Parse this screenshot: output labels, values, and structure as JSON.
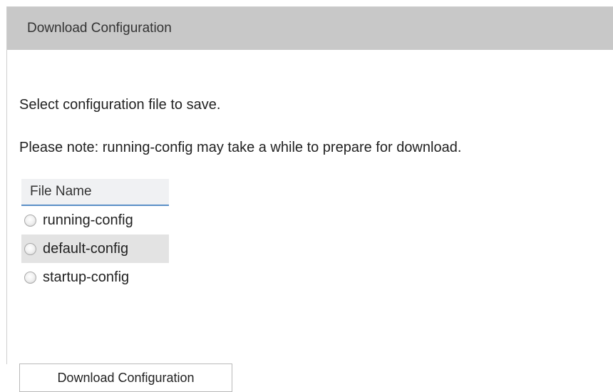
{
  "header": {
    "title": "Download Configuration"
  },
  "description": {
    "line1": "Select configuration file to save.",
    "line2": "Please note: running-config may take a while to prepare for download."
  },
  "file_table": {
    "column_header": "File Name",
    "options": [
      {
        "label": "running-config",
        "selected": false,
        "highlighted": false
      },
      {
        "label": "default-config",
        "selected": false,
        "highlighted": true
      },
      {
        "label": "startup-config",
        "selected": false,
        "highlighted": false
      }
    ]
  },
  "actions": {
    "download_label": "Download Configuration"
  }
}
